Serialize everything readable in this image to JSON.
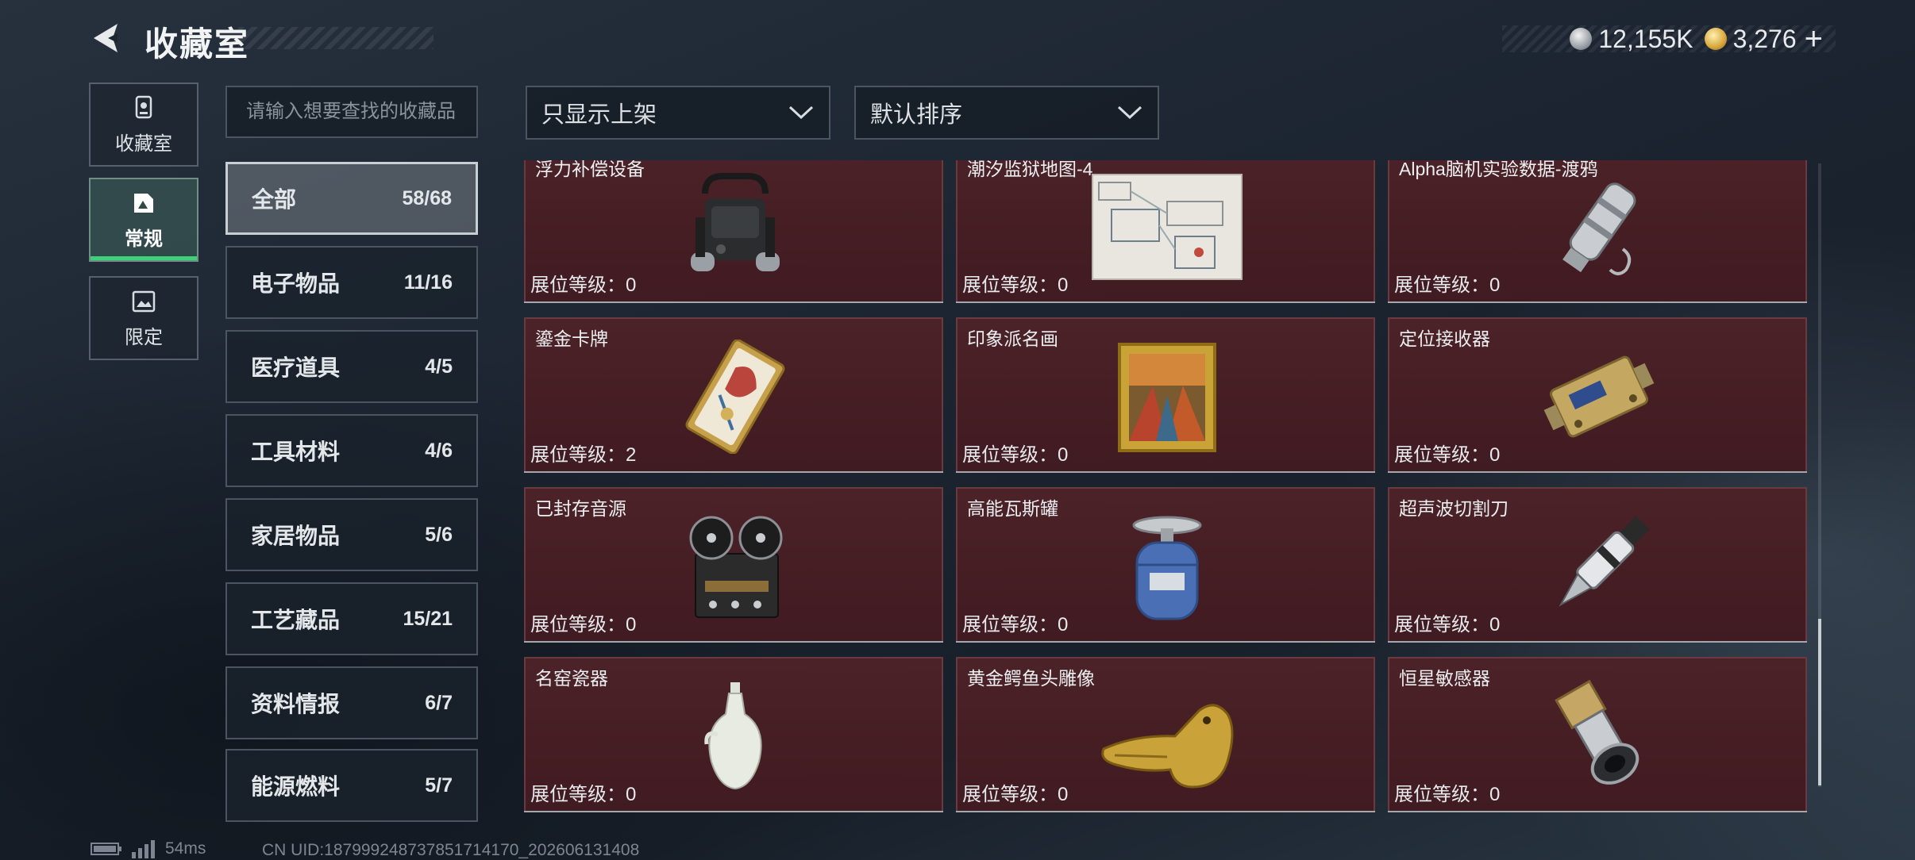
{
  "header": {
    "title": "收藏室"
  },
  "currency": {
    "silver": {
      "icon": "silver-coin-icon",
      "value": "12,155K"
    },
    "gold": {
      "icon": "gold-coin-icon",
      "value": "3,276"
    },
    "plus": "+"
  },
  "rail": [
    {
      "label": "收藏室",
      "icon": "trophy-icon"
    },
    {
      "label": "常规",
      "icon": "photo-icon",
      "active": true
    },
    {
      "label": "限定",
      "icon": "landscape-icon"
    }
  ],
  "search": {
    "placeholder": "请输入想要查找的收藏品",
    "value": ""
  },
  "filters": {
    "listing": {
      "label": "只显示上架"
    },
    "sort": {
      "label": "默认排序"
    }
  },
  "categories": [
    {
      "name": "全部",
      "count": "58/68",
      "active": true
    },
    {
      "name": "电子物品",
      "count": "11/16"
    },
    {
      "name": "医疗道具",
      "count": "4/5"
    },
    {
      "name": "工具材料",
      "count": "4/6"
    },
    {
      "name": "家居物品",
      "count": "5/6"
    },
    {
      "name": "工艺藏品",
      "count": "15/21"
    },
    {
      "name": "资料情报",
      "count": "6/7"
    },
    {
      "name": "能源燃料",
      "count": "5/7"
    }
  ],
  "items": [
    {
      "name": "浮力补偿设备",
      "level": "展位等级：0",
      "icon": "bcd-device-icon"
    },
    {
      "name": "潮汐监狱地图-4",
      "level": "展位等级：0",
      "icon": "map-icon"
    },
    {
      "name": "Alpha脑机实验数据-渡鸦",
      "level": "展位等级：0",
      "icon": "data-canister-icon"
    },
    {
      "name": "鎏金卡牌",
      "level": "展位等级：2",
      "icon": "gilded-card-icon"
    },
    {
      "name": "印象派名画",
      "level": "展位等级：0",
      "icon": "painting-icon"
    },
    {
      "name": "定位接收器",
      "level": "展位等级：0",
      "icon": "gps-receiver-icon"
    },
    {
      "name": "已封存音源",
      "level": "展位等级：0",
      "icon": "reel-recorder-icon"
    },
    {
      "name": "高能瓦斯罐",
      "level": "展位等级：0",
      "icon": "gas-tank-icon"
    },
    {
      "name": "超声波切割刀",
      "level": "展位等级：0",
      "icon": "ultrasonic-cutter-icon"
    },
    {
      "name": "名窑瓷器",
      "level": "展位等级：0",
      "icon": "porcelain-vase-icon"
    },
    {
      "name": "黄金鳄鱼头雕像",
      "level": "展位等级：0",
      "icon": "gold-crocodile-icon"
    },
    {
      "name": "恒星敏感器",
      "level": "展位等级：0",
      "icon": "star-sensor-icon"
    }
  ],
  "status": {
    "ping": "54ms",
    "uid": "CN UID:1879992487378517141​70_202606131408"
  }
}
